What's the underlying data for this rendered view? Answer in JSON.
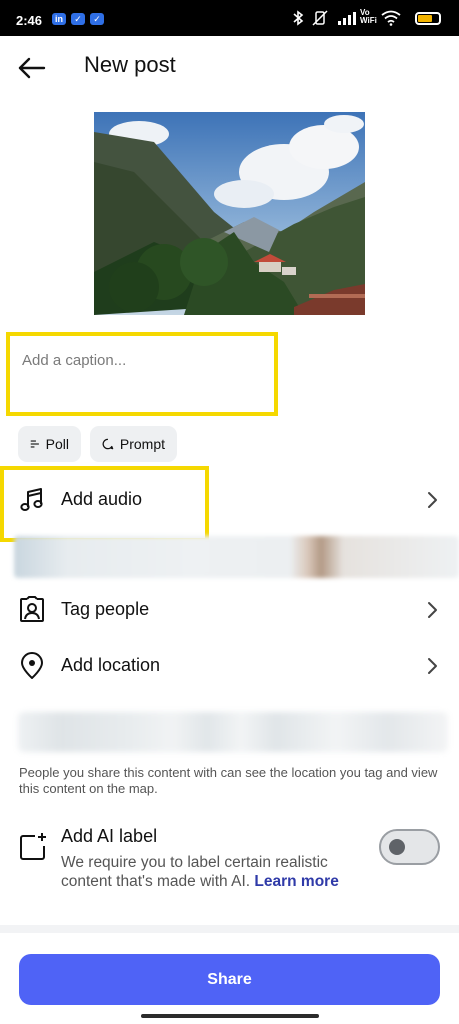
{
  "status_bar": {
    "time": "2:46",
    "app_icons": [
      "in",
      "✓",
      "✓"
    ],
    "network": "Vo WiFi"
  },
  "header": {
    "title": "New post",
    "back_icon": "arrow-left-icon"
  },
  "caption": {
    "placeholder": "Add a caption...",
    "value": ""
  },
  "chips": {
    "poll_label": "Poll",
    "prompt_label": "Prompt"
  },
  "rows": {
    "add_audio": "Add audio",
    "tag_people": "Tag people",
    "add_location": "Add location"
  },
  "location_info": "People you share this content with can see the location you tag and view this content on the map.",
  "ai_label": {
    "title": "Add AI label",
    "description": "We require you to label certain realistic content that's made with AI.",
    "learn_more": "Learn more",
    "enabled": false
  },
  "share_label": "Share",
  "colors": {
    "highlight": "#f5d800",
    "primary_button": "#4f63f6",
    "link": "#2f3aa8"
  }
}
